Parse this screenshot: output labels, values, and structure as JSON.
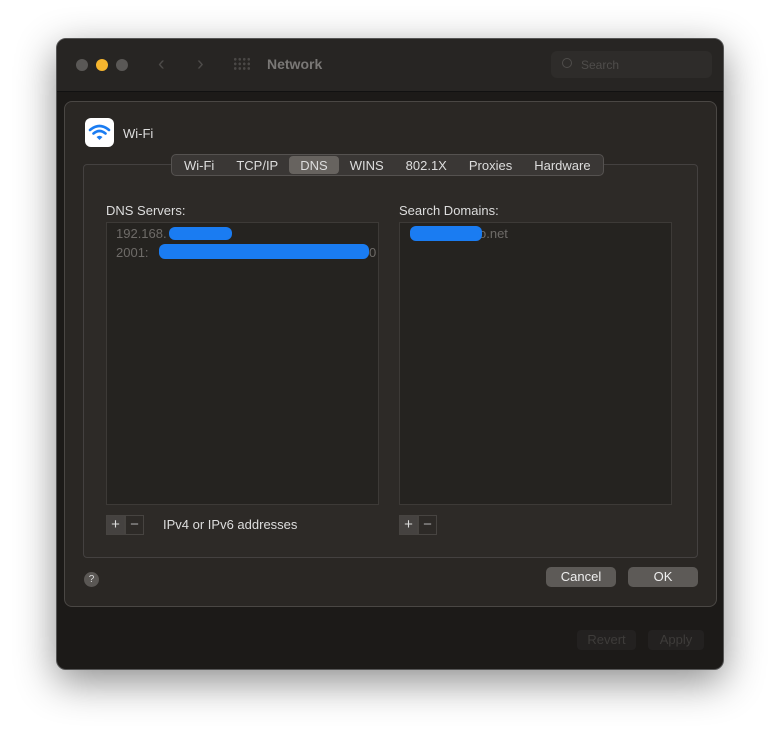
{
  "window": {
    "title": "Network",
    "search_placeholder": "Search",
    "revert": "Revert",
    "apply": "Apply",
    "traffic_colors": [
      "#5a5856",
      "#f5b52e",
      "#5a5856"
    ]
  },
  "sheet": {
    "interface": "Wi-Fi",
    "tabs": [
      {
        "label": "Wi-Fi"
      },
      {
        "label": "TCP/IP"
      },
      {
        "label": "DNS",
        "selected": true
      },
      {
        "label": "WINS"
      },
      {
        "label": "802.1X"
      },
      {
        "label": "Proxies"
      },
      {
        "label": "Hardware"
      }
    ],
    "dns_label": "DNS Servers:",
    "dns_servers": [
      "192.168.",
      "2001:",
      "0"
    ],
    "search_label": "Search Domains:",
    "search_domains": [
      "o.net"
    ],
    "dns_hint": "IPv4 or IPv6 addresses",
    "add": "+",
    "remove": "−",
    "cancel": "Cancel",
    "ok": "OK",
    "help": "?"
  },
  "accent": "#1a7cf2"
}
